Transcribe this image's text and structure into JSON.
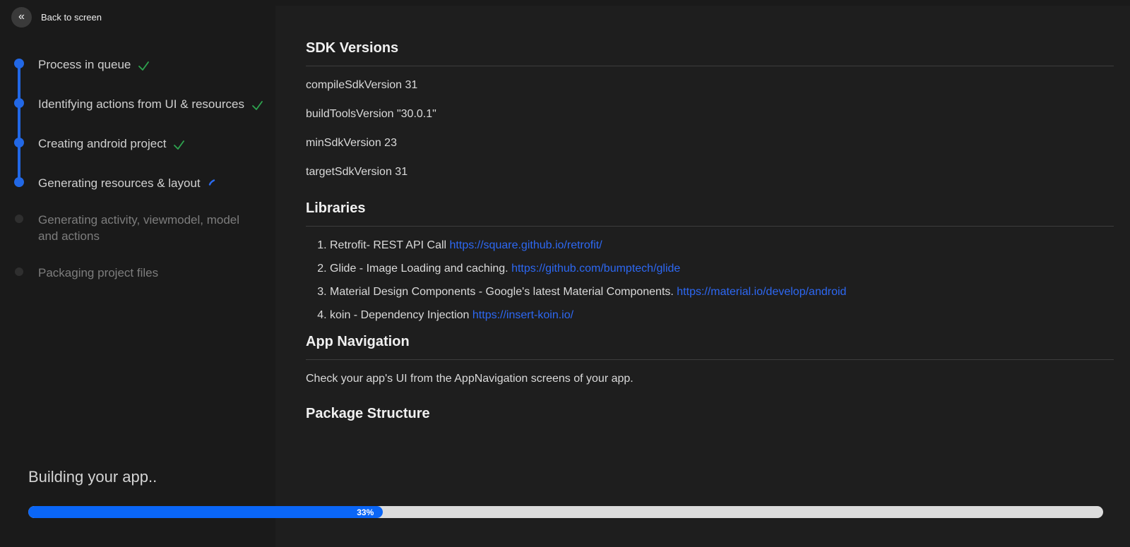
{
  "header": {
    "back_label": "Back to screen",
    "back_icon": "chevrons-left"
  },
  "stepper": {
    "steps": [
      {
        "label": "Process in queue",
        "status": "done"
      },
      {
        "label": "Identifying actions from UI & resources",
        "status": "done"
      },
      {
        "label": "Creating android project",
        "status": "done"
      },
      {
        "label": "Generating resources & layout",
        "status": "in-progress"
      },
      {
        "label": "Generating activity, viewmodel, model and actions",
        "status": "pending"
      },
      {
        "label": "Packaging project files",
        "status": "pending"
      }
    ]
  },
  "main": {
    "sdk": {
      "title": "SDK Versions",
      "lines": [
        "compileSdkVersion 31",
        "buildToolsVersion \"30.0.1\"",
        "minSdkVersion 23",
        "targetSdkVersion 31"
      ]
    },
    "libraries": {
      "title": "Libraries",
      "items": [
        {
          "text": "Retrofit- REST API Call ",
          "link": "https://square.github.io/retrofit/"
        },
        {
          "text": "Glide - Image Loading and caching. ",
          "link": "https://github.com/bumptech/glide"
        },
        {
          "text": "Material Design Components - Google's latest Material Components. ",
          "link": "https://material.io/develop/android"
        },
        {
          "text": "koin - Dependency Injection ",
          "link": "https://insert-koin.io/"
        }
      ]
    },
    "app_navigation": {
      "title": "App Navigation",
      "body": "Check your app's UI from the AppNavigation screens of your app."
    },
    "package_structure": {
      "title": "Package Structure"
    }
  },
  "footer": {
    "status_text": "Building your app..",
    "progress_percent": 33,
    "progress_label": "33%"
  },
  "colors": {
    "accent_blue": "#2268e6",
    "link_blue": "#2d68f3",
    "success_green": "#2ea44f",
    "progress_fill": "#0a66f7",
    "progress_track": "#dcdcdc",
    "background": "#1a1a1a",
    "panel_background": "#1e1e1e"
  }
}
